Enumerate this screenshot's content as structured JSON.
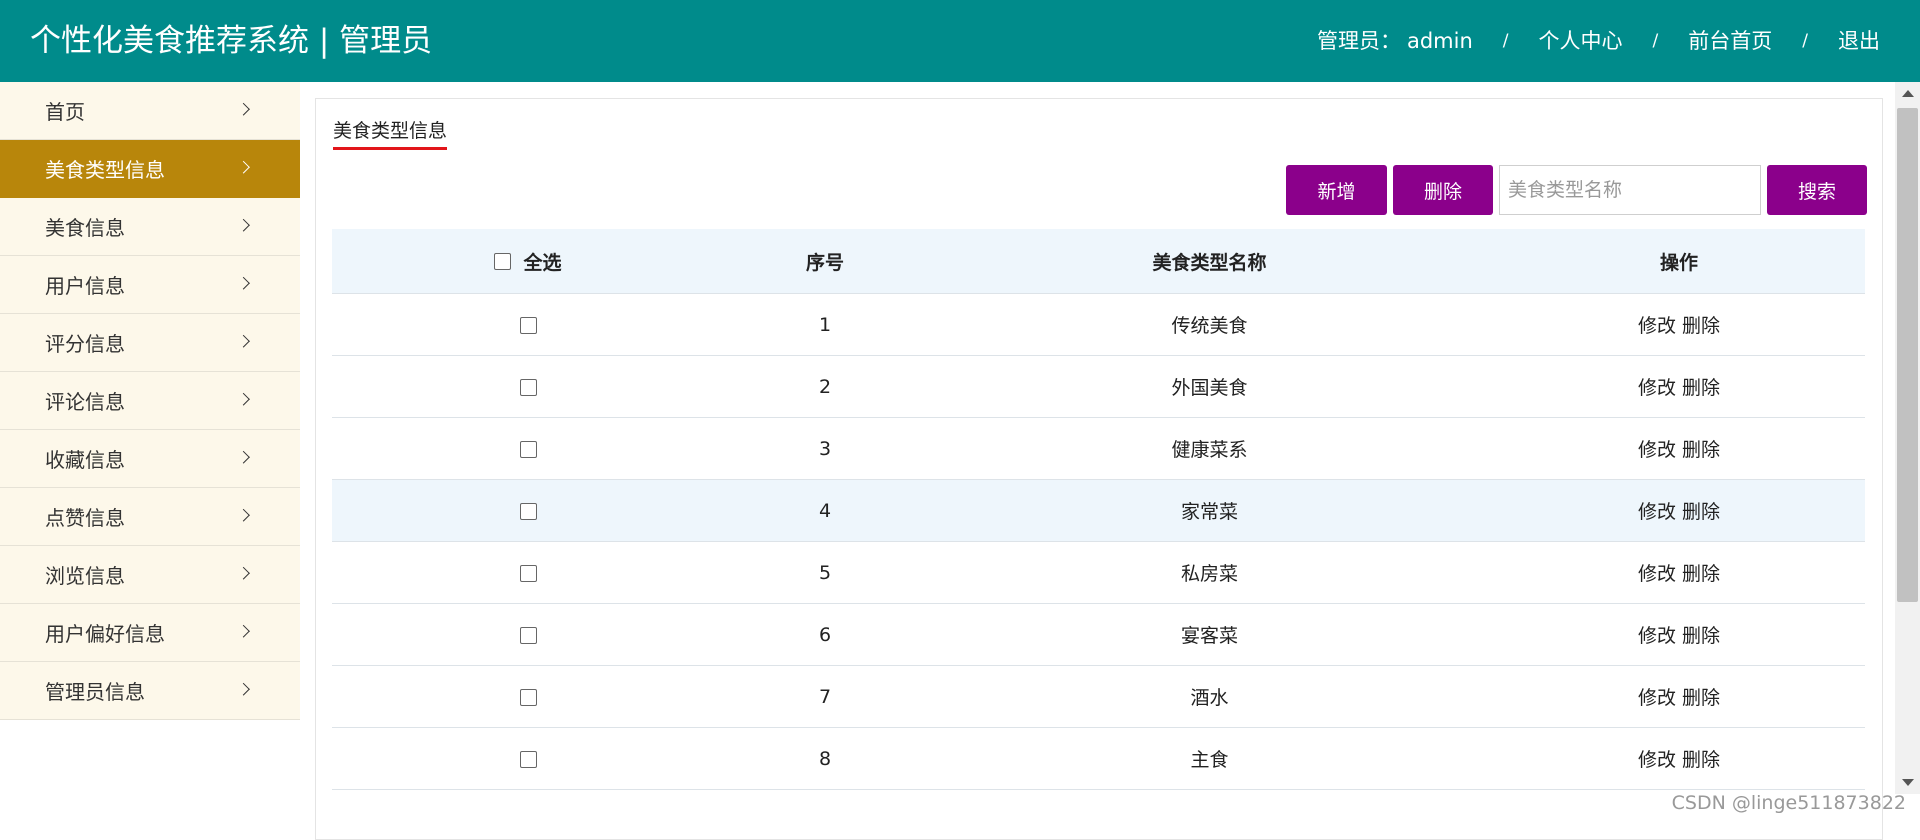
{
  "header": {
    "title": "个性化美食推荐系统 | 管理员",
    "admin_label": "管理员：",
    "admin_name": "admin",
    "separator": "/",
    "nav": [
      "个人中心",
      "前台首页",
      "退出"
    ]
  },
  "sidebar": {
    "items": [
      {
        "label": "首页"
      },
      {
        "label": "美食类型信息",
        "active": true
      },
      {
        "label": "美食信息"
      },
      {
        "label": "用户信息"
      },
      {
        "label": "评分信息"
      },
      {
        "label": "评论信息"
      },
      {
        "label": "收藏信息"
      },
      {
        "label": "点赞信息"
      },
      {
        "label": "浏览信息"
      },
      {
        "label": "用户偏好信息"
      },
      {
        "label": "管理员信息"
      }
    ]
  },
  "main": {
    "breadcrumb": "美食类型信息",
    "toolbar": {
      "add_label": "新增",
      "delete_label": "删除",
      "search_placeholder": "美食类型名称",
      "search_label": "搜索"
    },
    "table": {
      "columns": [
        "全选",
        "序号",
        "美食类型名称",
        "操作"
      ],
      "rows": [
        {
          "index": "1",
          "name": "传统美食"
        },
        {
          "index": "2",
          "name": "外国美食"
        },
        {
          "index": "3",
          "name": "健康菜系"
        },
        {
          "index": "4",
          "name": "家常菜",
          "highlighted": true
        },
        {
          "index": "5",
          "name": "私房菜"
        },
        {
          "index": "6",
          "name": "宴客菜"
        },
        {
          "index": "7",
          "name": "酒水"
        },
        {
          "index": "8",
          "name": "主食"
        }
      ],
      "row_actions": {
        "edit": "修改",
        "delete": "删除"
      }
    }
  },
  "watermark": "CSDN @linge511873822",
  "colors": {
    "header_bg": "#008b8b",
    "sidebar_bg": "#fdf8ea",
    "sidebar_active_bg": "#b8860b",
    "button_bg": "#8b008b",
    "table_header_bg": "#eef6fc",
    "breadcrumb_underline": "#e2151a"
  }
}
